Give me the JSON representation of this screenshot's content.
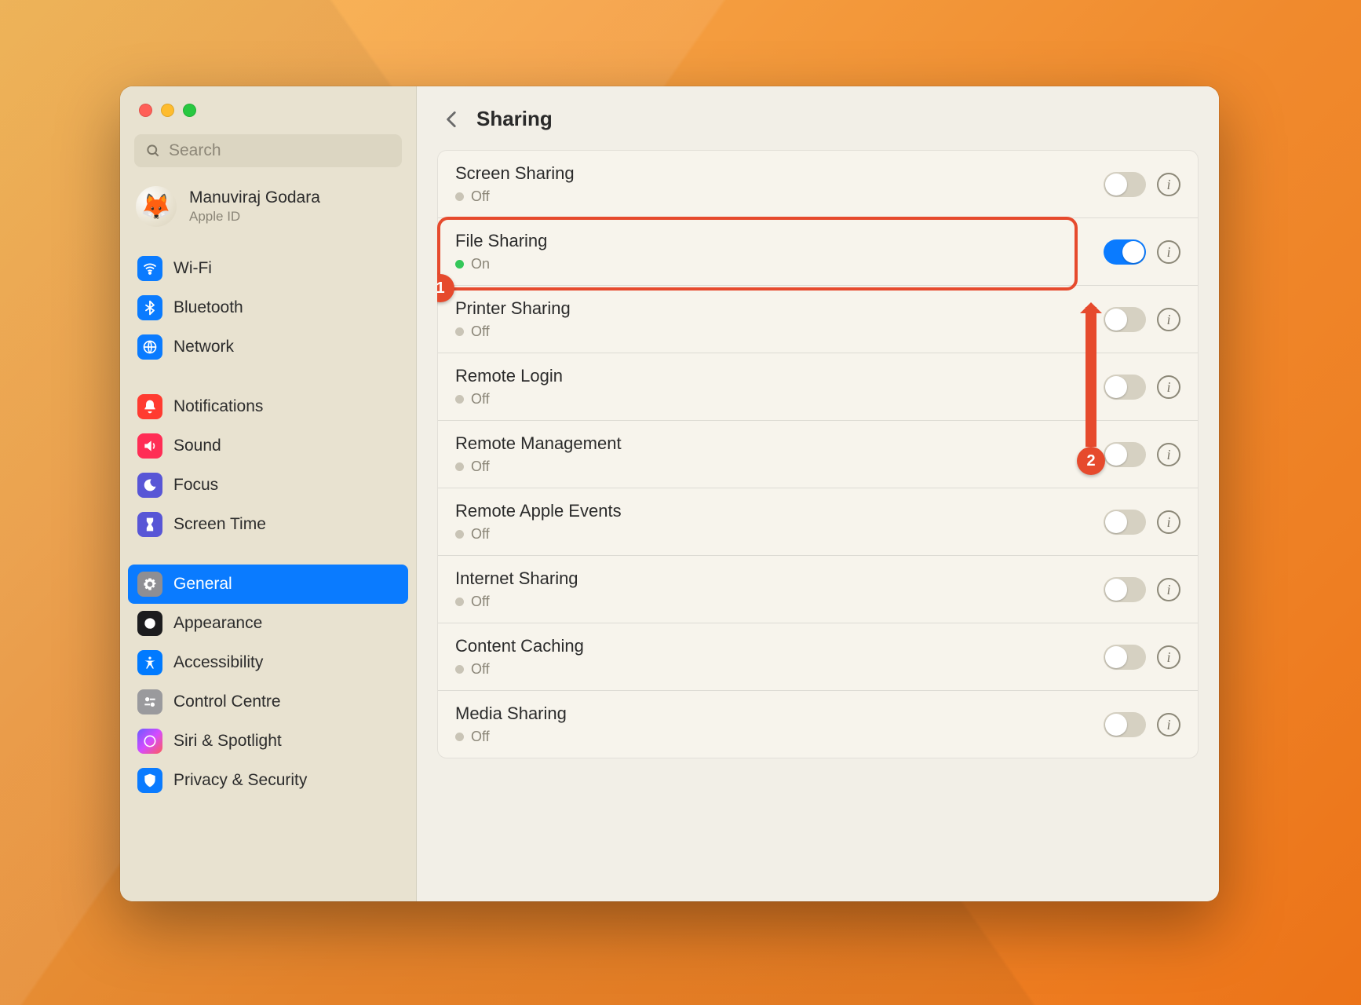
{
  "window": {
    "title": "Sharing",
    "search_placeholder": "Search"
  },
  "account": {
    "name": "Manuviraj Godara",
    "subtitle": "Apple ID",
    "avatar_emoji": "🦊"
  },
  "sidebar": {
    "groups": [
      {
        "items": [
          {
            "id": "wifi",
            "label": "Wi-Fi"
          },
          {
            "id": "bluetooth",
            "label": "Bluetooth"
          },
          {
            "id": "network",
            "label": "Network"
          }
        ]
      },
      {
        "items": [
          {
            "id": "notifications",
            "label": "Notifications"
          },
          {
            "id": "sound",
            "label": "Sound"
          },
          {
            "id": "focus",
            "label": "Focus"
          },
          {
            "id": "screentime",
            "label": "Screen Time"
          }
        ]
      },
      {
        "items": [
          {
            "id": "general",
            "label": "General",
            "selected": true
          },
          {
            "id": "appearance",
            "label": "Appearance"
          },
          {
            "id": "accessibility",
            "label": "Accessibility"
          },
          {
            "id": "controlcentre",
            "label": "Control Centre"
          },
          {
            "id": "siri",
            "label": "Siri & Spotlight"
          },
          {
            "id": "privacy",
            "label": "Privacy & Security"
          }
        ]
      }
    ]
  },
  "sharing": {
    "status_on": "On",
    "status_off": "Off",
    "items": [
      {
        "id": "screen",
        "label": "Screen Sharing",
        "on": false
      },
      {
        "id": "file",
        "label": "File Sharing",
        "on": true
      },
      {
        "id": "printer",
        "label": "Printer Sharing",
        "on": false
      },
      {
        "id": "rlogin",
        "label": "Remote Login",
        "on": false
      },
      {
        "id": "rmanage",
        "label": "Remote Management",
        "on": false
      },
      {
        "id": "revents",
        "label": "Remote Apple Events",
        "on": false
      },
      {
        "id": "internet",
        "label": "Internet Sharing",
        "on": false
      },
      {
        "id": "cache",
        "label": "Content Caching",
        "on": false
      },
      {
        "id": "media",
        "label": "Media Sharing",
        "on": false
      }
    ]
  },
  "annotations": {
    "callout1": "1",
    "callout2": "2"
  },
  "colors": {
    "accent": "#0a7bff",
    "highlight": "#e64a2d",
    "status_on": "#34c759"
  }
}
